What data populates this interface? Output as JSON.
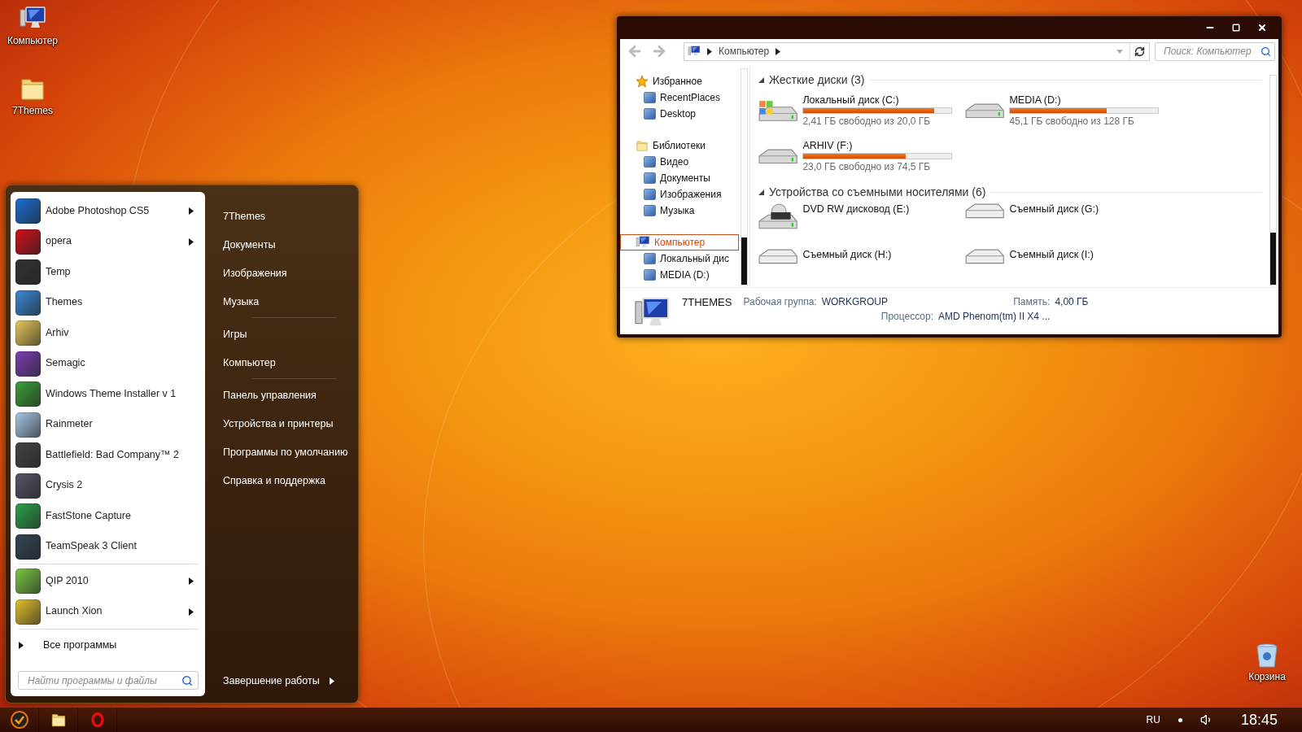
{
  "desktop_icons": [
    {
      "label": "Компьютер",
      "kind": "computer"
    },
    {
      "label": "7Themes",
      "kind": "folder"
    },
    {
      "label": "Корзина",
      "kind": "trash"
    }
  ],
  "start_menu": {
    "program_groups": [
      {
        "items": [
          {
            "label": "Adobe Photoshop CS5",
            "submenu": true
          },
          {
            "label": "opera",
            "submenu": true
          },
          {
            "label": "Temp",
            "submenu": false
          },
          {
            "label": "Themes",
            "submenu": false
          },
          {
            "label": "Arhiv",
            "submenu": false
          },
          {
            "label": "Semagic",
            "submenu": false
          },
          {
            "label": "Windows Theme Installer v 1",
            "submenu": false
          },
          {
            "label": "Rainmeter",
            "submenu": false
          },
          {
            "label": "Battlefield: Bad Company™ 2",
            "submenu": false
          },
          {
            "label": "Crysis 2",
            "submenu": false
          },
          {
            "label": "FastStone Capture",
            "submenu": false
          },
          {
            "label": "TeamSpeak 3 Client",
            "submenu": false
          }
        ]
      },
      {
        "items": [
          {
            "label": "QIP 2010",
            "submenu": true
          },
          {
            "label": "Launch Xion",
            "submenu": true
          }
        ]
      }
    ],
    "all_programs": "Все программы",
    "search": {
      "placeholder": "Найти программы и файлы"
    },
    "place_groups": [
      {
        "items": [
          "7Themes",
          "Документы",
          "Изображения",
          "Музыка"
        ]
      },
      {
        "items": [
          "Игры",
          "Компьютер"
        ]
      },
      {
        "items": [
          "Панель управления",
          "Устройства и принтеры",
          "Программы по умолчанию",
          "Справка и поддержка"
        ]
      }
    ],
    "shutdown": "Завершение работы"
  },
  "explorer": {
    "breadcrumb": [
      "Компьютер"
    ],
    "search": {
      "placeholder": "Поиск: Компьютер"
    },
    "nav": [
      {
        "label": "Избранное",
        "kind": "favorites",
        "selected": false,
        "children": [
          {
            "label": "RecentPlaces",
            "selected": false
          },
          {
            "label": "Desktop",
            "selected": false
          }
        ]
      },
      {
        "label": "Библиотеки",
        "kind": "libraries",
        "selected": false,
        "children": [
          {
            "label": "Видео",
            "selected": false
          },
          {
            "label": "Документы",
            "selected": false
          },
          {
            "label": "Изображения",
            "selected": false
          },
          {
            "label": "Музыка",
            "selected": false
          }
        ]
      },
      {
        "label": "Компьютер",
        "kind": "computer",
        "selected": true,
        "children": [
          {
            "label": "Локальный дис",
            "selected": false
          },
          {
            "label": "MEDIA (D:)",
            "selected": false
          }
        ]
      }
    ],
    "groups": [
      {
        "title": "Жесткие диски (3)",
        "expanded": true,
        "drives": [
          {
            "name": "Локальный диск (C:)",
            "kind": "system",
            "level": 0.88,
            "reading": "2,41 ГБ свободно из 20,0 ГБ"
          },
          {
            "name": "MEDIA (D:)",
            "kind": "hdd",
            "level": 0.65,
            "reading": "45,1 ГБ свободно из 128 ГБ"
          },
          {
            "name": "ARHIV (F:)",
            "kind": "hdd",
            "level": 0.69,
            "reading": "23,0 ГБ свободно из 74,5 ГБ"
          }
        ]
      },
      {
        "title": "Устройства со съемными носителями (6)",
        "expanded": true,
        "drives": [
          {
            "name": "DVD RW дисковод (E:)",
            "kind": "dvd"
          },
          {
            "name": "Съемный диск (G:)",
            "kind": "removable"
          },
          {
            "name": "Съемный диск (H:)",
            "kind": "removable"
          },
          {
            "name": "Съемный диск (I:)",
            "kind": "removable"
          }
        ]
      }
    ],
    "details": {
      "name": "7THEMES",
      "fields": [
        {
          "label": "Рабочая группа:",
          "value": "WORKGROUP"
        },
        {
          "label": "Память:",
          "value": "4,00 ГБ"
        },
        {
          "label": "Процессор:",
          "value": "AMD Phenom(tm) II X4 ..."
        }
      ]
    }
  },
  "taskbar": {
    "language": "RU",
    "time": "18:45"
  }
}
